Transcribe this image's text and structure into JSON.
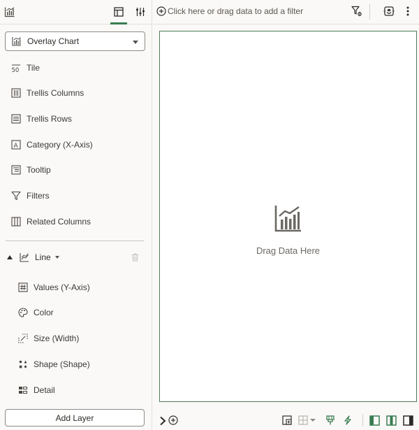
{
  "left_panel": {
    "toolbar": {
      "visualize_icon": "bar-chart-icon",
      "grammar_tab_icon": "grammar-panel-icon",
      "properties_tab_icon": "sliders-icon"
    },
    "chart_type": {
      "value": "Overlay Chart"
    },
    "grammar": [
      {
        "label": "Tile",
        "icon": "tile-icon"
      },
      {
        "label": "Trellis Columns",
        "icon": "trellis-columns-icon"
      },
      {
        "label": "Trellis Rows",
        "icon": "trellis-rows-icon"
      },
      {
        "label": "Category (X-Axis)",
        "icon": "category-icon"
      },
      {
        "label": "Tooltip",
        "icon": "tooltip-icon"
      },
      {
        "label": "Filters",
        "icon": "filter-icon"
      },
      {
        "label": "Related Columns",
        "icon": "related-columns-icon"
      }
    ],
    "layer": {
      "name": "Line",
      "items": [
        {
          "label": "Values (Y-Axis)",
          "icon": "hash-icon"
        },
        {
          "label": "Color",
          "icon": "palette-icon"
        },
        {
          "label": "Size (Width)",
          "icon": "size-icon"
        },
        {
          "label": "Shape (Shape)",
          "icon": "shape-icon"
        },
        {
          "label": "Detail",
          "icon": "detail-icon"
        }
      ]
    },
    "add_layer_label": "Add Layer"
  },
  "filter_bar": {
    "placeholder": "Click here or drag data to add a filter"
  },
  "canvas": {
    "drag_text": "Drag Data Here"
  },
  "colors": {
    "accent_green": "#3a7d52",
    "canvas_border": "#4f7a58"
  }
}
